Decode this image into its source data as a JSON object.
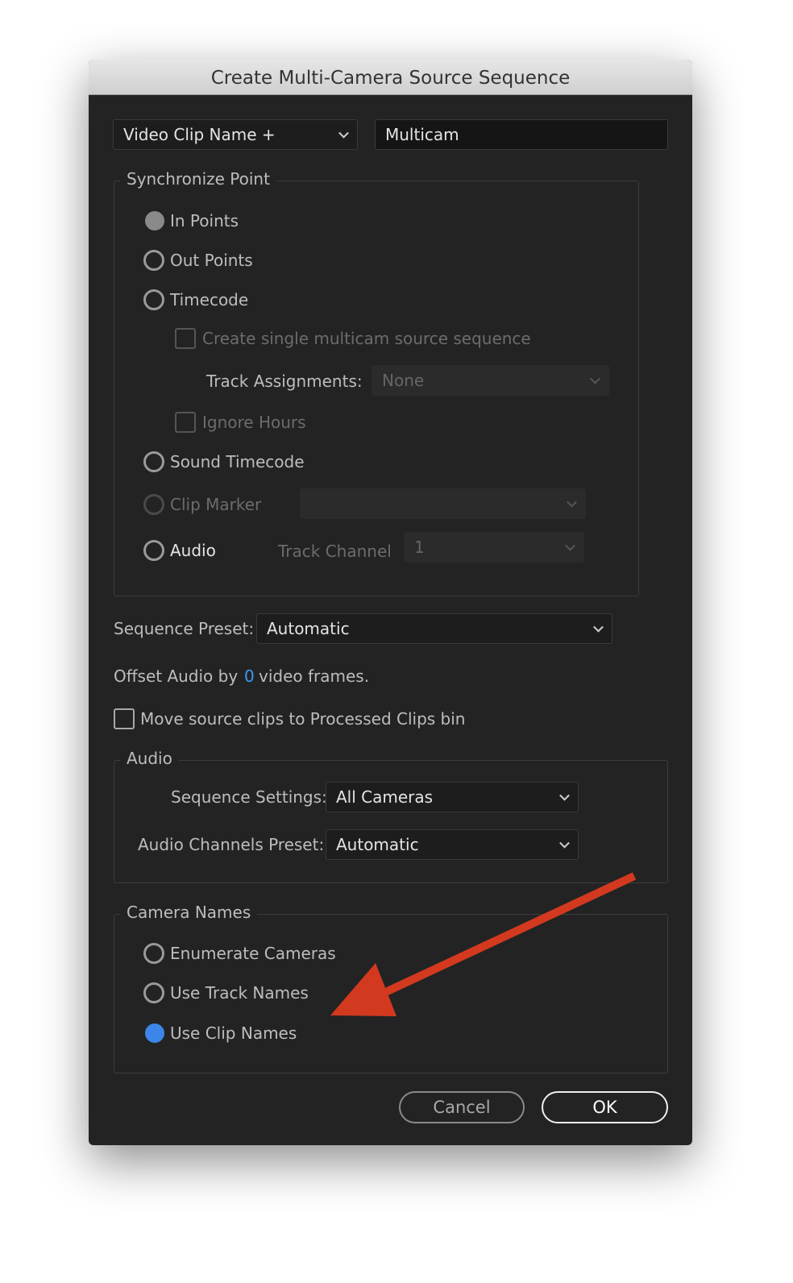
{
  "dialog": {
    "title": "Create Multi-Camera Source Sequence"
  },
  "naming": {
    "preset": "Video Clip Name +",
    "name_value": "Multicam"
  },
  "sync": {
    "legend": "Synchronize Point",
    "in_points": "In Points",
    "out_points": "Out Points",
    "timecode": "Timecode",
    "single_multicam": "Create single multicam source sequence",
    "track_assignments_label": "Track Assignments:",
    "track_assignments_value": "None",
    "ignore_hours": "Ignore Hours",
    "sound_timecode": "Sound Timecode",
    "clip_marker": "Clip Marker",
    "clip_marker_value": "",
    "audio": "Audio",
    "track_channel_label": "Track Channel",
    "track_channel_value": "1",
    "selected": "In Points"
  },
  "sequence_preset": {
    "label": "Sequence Preset:",
    "value": "Automatic"
  },
  "offset": {
    "prefix": "Offset Audio by",
    "value": "0",
    "suffix": "video frames."
  },
  "move_clips": {
    "label": "Move source clips to Processed Clips bin",
    "checked": false
  },
  "audio": {
    "legend": "Audio",
    "sequence_settings_label": "Sequence Settings:",
    "sequence_settings_value": "All Cameras",
    "channels_preset_label": "Audio Channels Preset:",
    "channels_preset_value": "Automatic"
  },
  "camera_names": {
    "legend": "Camera Names",
    "enumerate": "Enumerate Cameras",
    "track_names": "Use Track Names",
    "clip_names": "Use Clip Names",
    "selected": "Use Clip Names"
  },
  "buttons": {
    "cancel": "Cancel",
    "ok": "OK"
  },
  "colors": {
    "accent": "#3b86e8",
    "annotation_arrow": "#d2391f"
  }
}
